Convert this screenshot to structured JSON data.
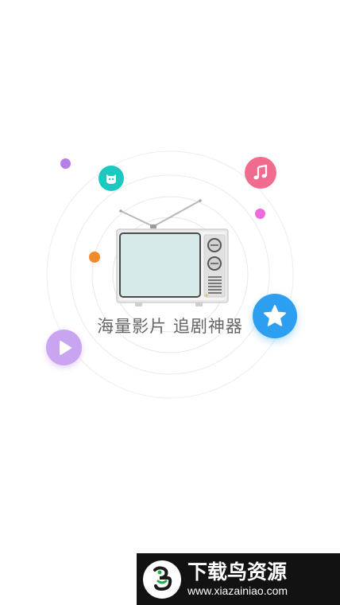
{
  "splash": {
    "tagline": "海量影片 追剧神器"
  },
  "icons": {
    "tv": "television-illustration",
    "cat": "cat-face-icon",
    "music": "music-note-icon",
    "star": "star-icon",
    "play": "play-icon"
  },
  "colors": {
    "ring": "#ededed",
    "teal": "#1bc9c0",
    "pink": "#f06b8e",
    "blue": "#2c9ff0",
    "purple": "#c9a4f0",
    "orange": "#f08a2c",
    "magenta": "#ec6bdc",
    "violet": "#b77ee8"
  },
  "watermark": {
    "title": "下载鸟资源",
    "url": "www.xiazainiao.com"
  }
}
